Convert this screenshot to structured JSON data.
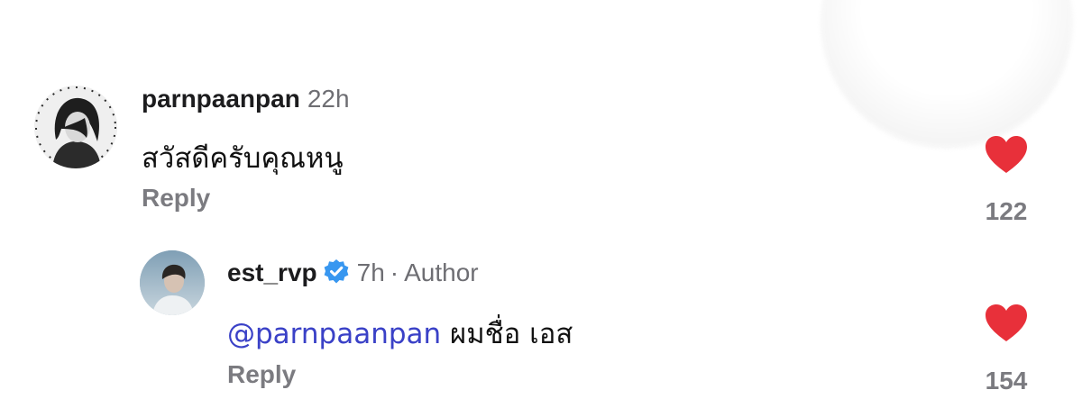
{
  "colors": {
    "like_red": "#e8303a",
    "mention_blue": "#3a41c7",
    "verified_blue": "#3897f0",
    "muted_gray": "#7b7b80"
  },
  "comments": [
    {
      "username": "parnpaanpan",
      "time": "22h",
      "text": "สวัสดีครับคุณหนู",
      "reply_label": "Reply",
      "like_count": "122",
      "liked": true
    }
  ],
  "reply": {
    "username": "est_rvp",
    "verified": true,
    "time": "7h",
    "separator": "·",
    "author_label": "Author",
    "mention": "@parnpaanpan",
    "text": "ผมชื่อ เอส",
    "reply_label": "Reply",
    "like_count": "154",
    "liked": true
  }
}
